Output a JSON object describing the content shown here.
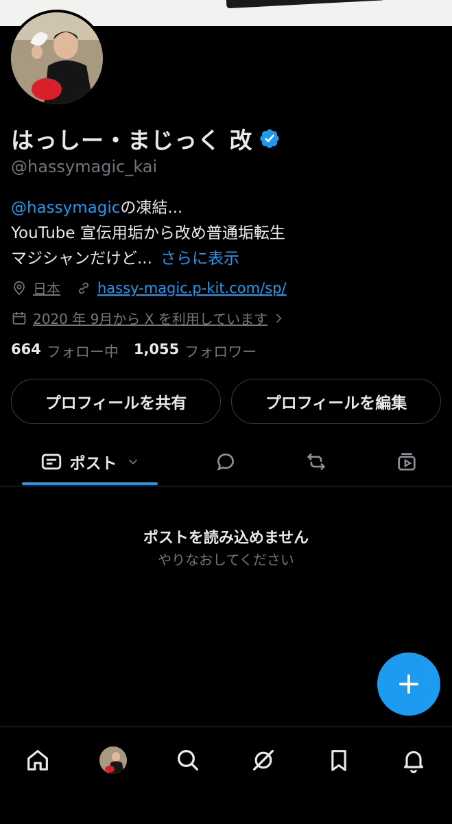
{
  "profile": {
    "name": "はっしー・まじっく 改",
    "handle": "@hassymagic_kai",
    "bio_mention": "@hassymagic",
    "bio_line1_rest": "の凍結...",
    "bio_line2": "YouTube 宣伝用垢から改め普通垢転生",
    "bio_line3": "マジシャンだけど...",
    "bio_more": "さらに表示",
    "location": "日本",
    "website": "hassy-magic.p-kit.com/sp/",
    "joined": "2020 年 9月から X を利用しています",
    "following_count": "664",
    "following_label": "フォロー中",
    "followers_count": "1,055",
    "followers_label": "フォロワー"
  },
  "actions": {
    "share_label": "プロフィールを共有",
    "edit_label": "プロフィールを編集"
  },
  "tabs": {
    "posts_label": "ポスト"
  },
  "empty_state": {
    "title": "ポストを読み込めません",
    "subtitle": "やりなおしてください"
  },
  "colors": {
    "accent": "#1d9bf0",
    "background": "#000000",
    "muted": "#71767b",
    "border": "#2f3336"
  },
  "icons": {
    "verified": "verified-badge-icon",
    "location": "location-pin-icon",
    "link": "link-icon",
    "calendar": "calendar-icon",
    "posts_tab": "posts-icon",
    "replies_tab": "reply-icon",
    "reposts_tab": "repost-icon",
    "media_tab": "video-icon",
    "compose": "plus-icon",
    "home": "home-icon",
    "search": "search-icon",
    "grok": "grok-icon",
    "bookmarks": "bookmark-icon",
    "notifications": "bell-icon"
  }
}
